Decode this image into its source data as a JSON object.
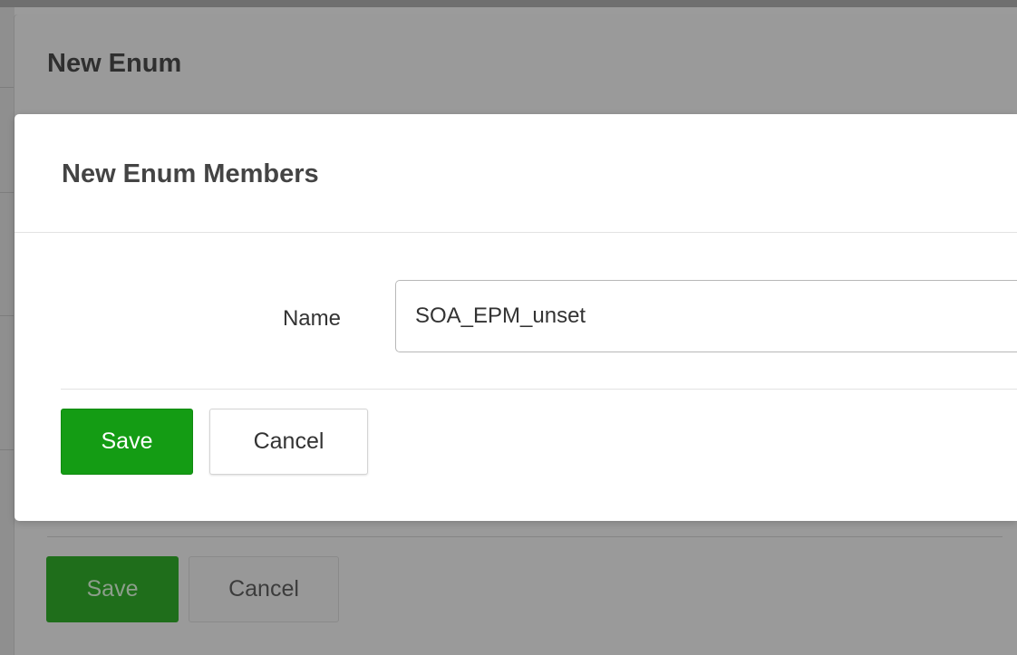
{
  "background_form": {
    "title": "New Enum",
    "save_label": "Save",
    "cancel_label": "Cancel"
  },
  "dialog": {
    "title": "New Enum Members",
    "name_field": {
      "label": "Name",
      "value": "SOA_EPM_unset"
    },
    "save_label": "Save",
    "cancel_label": "Cancel"
  },
  "colors": {
    "save_button": "#149c14",
    "overlay": "#9b9b9b"
  }
}
